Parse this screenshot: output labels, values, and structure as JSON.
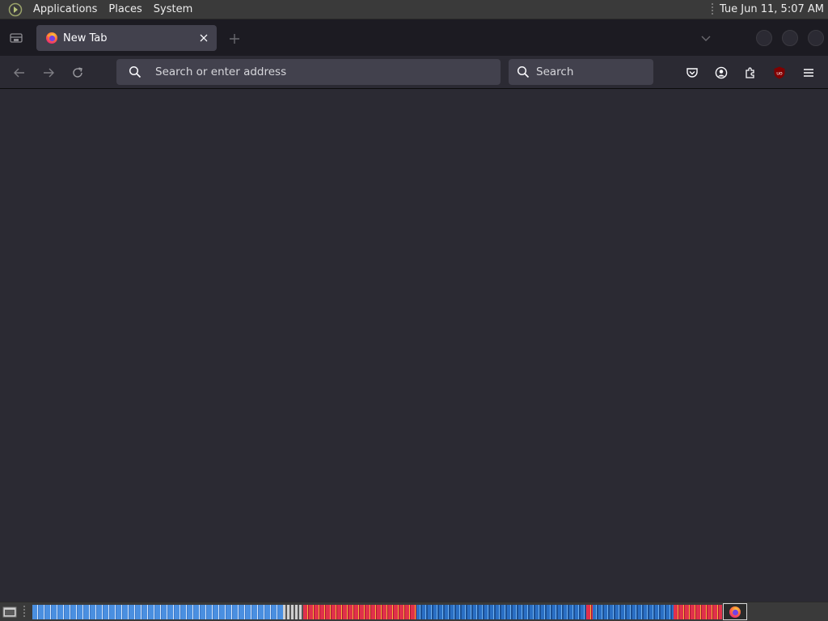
{
  "top_panel": {
    "menus": [
      "Applications",
      "Places",
      "System"
    ],
    "clock": "Tue Jun 11,  5:07 AM"
  },
  "browser": {
    "tab": {
      "title": "New Tab"
    },
    "urlbar": {
      "placeholder": "Search or enter address"
    },
    "searchbar": {
      "placeholder": "Search"
    },
    "icons": {
      "back": "arrow-left-icon",
      "forward": "arrow-right-icon",
      "reload": "reload-icon",
      "pocket": "pocket-icon",
      "account": "account-icon",
      "extensions": "puzzle-icon",
      "ublock": "ublock-icon",
      "menu": "hamburger-icon"
    },
    "ublock_badge": "uo"
  },
  "colors": {
    "toolbar": "#2b2a33",
    "tabstrip": "#1c1b22",
    "field": "#42414d",
    "panel": "#3a3a3a",
    "ublock": "#800000"
  }
}
